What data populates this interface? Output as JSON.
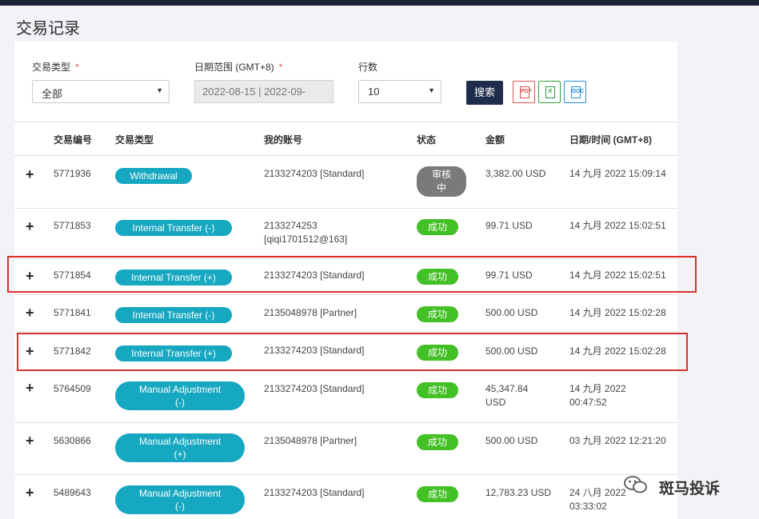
{
  "page": {
    "title": "交易记录"
  },
  "filters": {
    "type_label": "交易类型",
    "date_label": "日期范围 (GMT+8)",
    "rows_label": "行数",
    "required_mark": "*",
    "type_value": "全部",
    "date_value": "2022-08-15 | 2022-09-",
    "rows_value": "10",
    "search_label": "搜索",
    "export_icons": {
      "pdf": "PDF",
      "excel": "X",
      "doc": "DOC"
    }
  },
  "table": {
    "columns": [
      "交易编号",
      "交易类型",
      "我的账号",
      "状态",
      "金额",
      "日期/时间 (GMT+8)"
    ],
    "rows": [
      {
        "id": "5771936",
        "type1": "Withdrawal",
        "type2": "",
        "account1": "2133274203 [Standard]",
        "account2": "",
        "status1": "审核",
        "status2": "中",
        "amount1": "3,382.00 USD",
        "amount2": "",
        "date1": "14 九月 2022 15:09:14",
        "date2": ""
      },
      {
        "id": "5771853",
        "type1": "Internal Transfer (-)",
        "type2": "",
        "account1": "2133274253",
        "account2": "[qiqi1701512@163]",
        "status1": "成功",
        "status2": "",
        "amount1": "99.71 USD",
        "amount2": "",
        "date1": "14 九月 2022 15:02:51",
        "date2": ""
      },
      {
        "id": "5771854",
        "type1": "Internal Transfer (+)",
        "type2": "",
        "account1": "2133274203 [Standard]",
        "account2": "",
        "status1": "成功",
        "status2": "",
        "amount1": "99.71 USD",
        "amount2": "",
        "date1": "14 九月 2022 15:02:51",
        "date2": ""
      },
      {
        "id": "5771841",
        "type1": "Internal Transfer (-)",
        "type2": "",
        "account1": "2135048978 [Partner]",
        "account2": "",
        "status1": "成功",
        "status2": "",
        "amount1": "500.00 USD",
        "amount2": "",
        "date1": "14 九月 2022 15:02:28",
        "date2": ""
      },
      {
        "id": "5771842",
        "type1": "Internal Transfer (+)",
        "type2": "",
        "account1": "2133274203 [Standard]",
        "account2": "",
        "status1": "成功",
        "status2": "",
        "amount1": "500.00 USD",
        "amount2": "",
        "date1": "14 九月 2022 15:02:28",
        "date2": ""
      },
      {
        "id": "5764509",
        "type1": "Manual Adjustment",
        "type2": "(-)",
        "account1": "2133274203 [Standard]",
        "account2": "",
        "status1": "成功",
        "status2": "",
        "amount1": "45,347.84",
        "amount2": "USD",
        "date1": "14 九月 2022",
        "date2": "00:47:52"
      },
      {
        "id": "5630866",
        "type1": "Manual Adjustment",
        "type2": "(+)",
        "account1": "2135048978 [Partner]",
        "account2": "",
        "status1": "成功",
        "status2": "",
        "amount1": "500.00 USD",
        "amount2": "",
        "date1": "03 九月 2022 12:21:20",
        "date2": ""
      },
      {
        "id": "5489643",
        "type1": "Manual Adjustment",
        "type2": "(-)",
        "account1": "2133274203 [Standard]",
        "account2": "",
        "status1": "成功",
        "status2": "",
        "amount1": "12,783.23 USD",
        "amount2": "",
        "date1": "24 八月 2022",
        "date2": "03:33:02"
      }
    ]
  },
  "watermark": {
    "text": "斑马投诉"
  },
  "colors": {
    "topbar": "#1c2235",
    "pill": "#16a8c0",
    "success": "#43c026",
    "pending": "#7a7a7a",
    "search_button": "#1f2d4d",
    "highlight": "#d8302b"
  }
}
